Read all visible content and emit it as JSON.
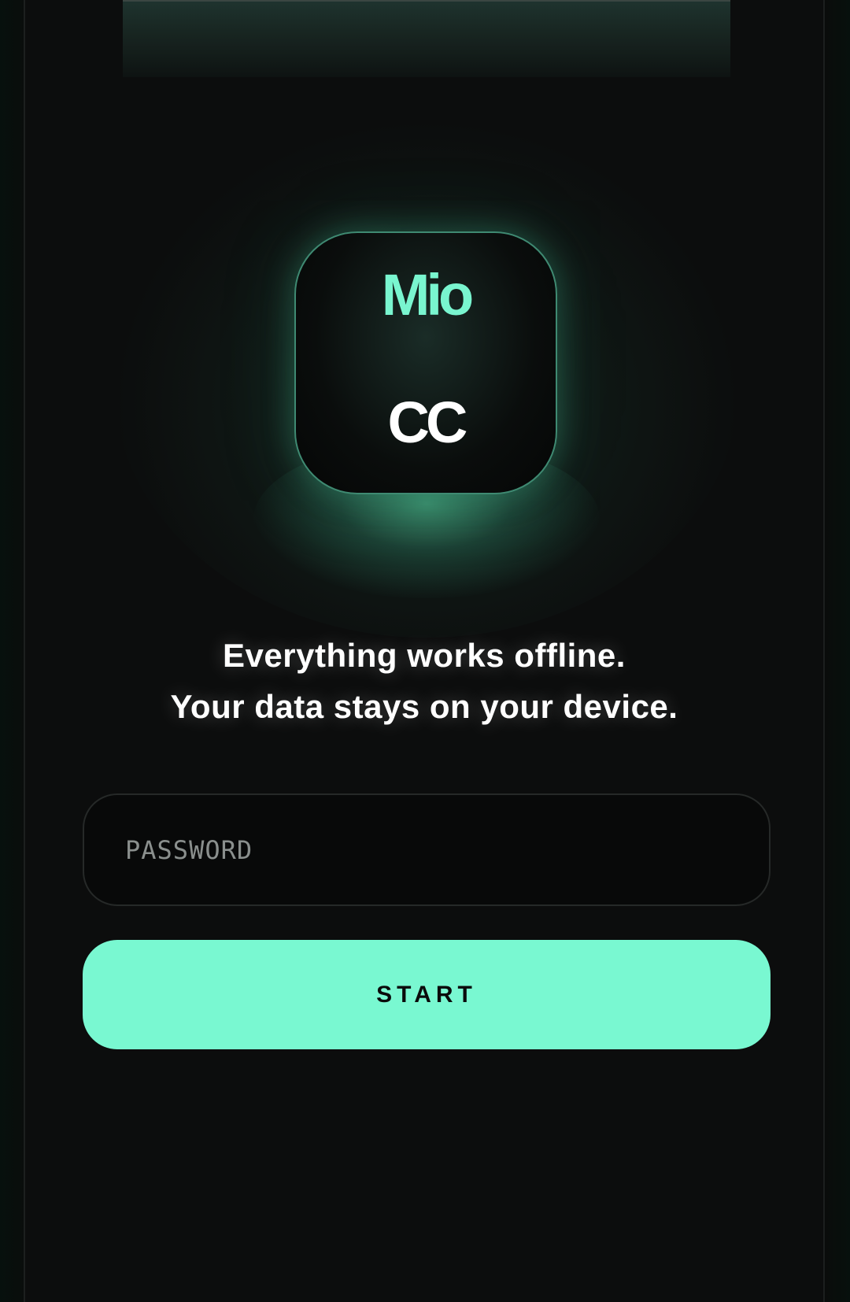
{
  "logo": {
    "top_text": "Mio",
    "bottom_text": "CC",
    "accent_color": "#79f5cf"
  },
  "tagline": {
    "line1": "Everything works offline.",
    "line2": "Your data stays on your device."
  },
  "password": {
    "placeholder": "PASSWORD",
    "value": ""
  },
  "start_button": {
    "label": "START",
    "color": "#79f8d1"
  }
}
